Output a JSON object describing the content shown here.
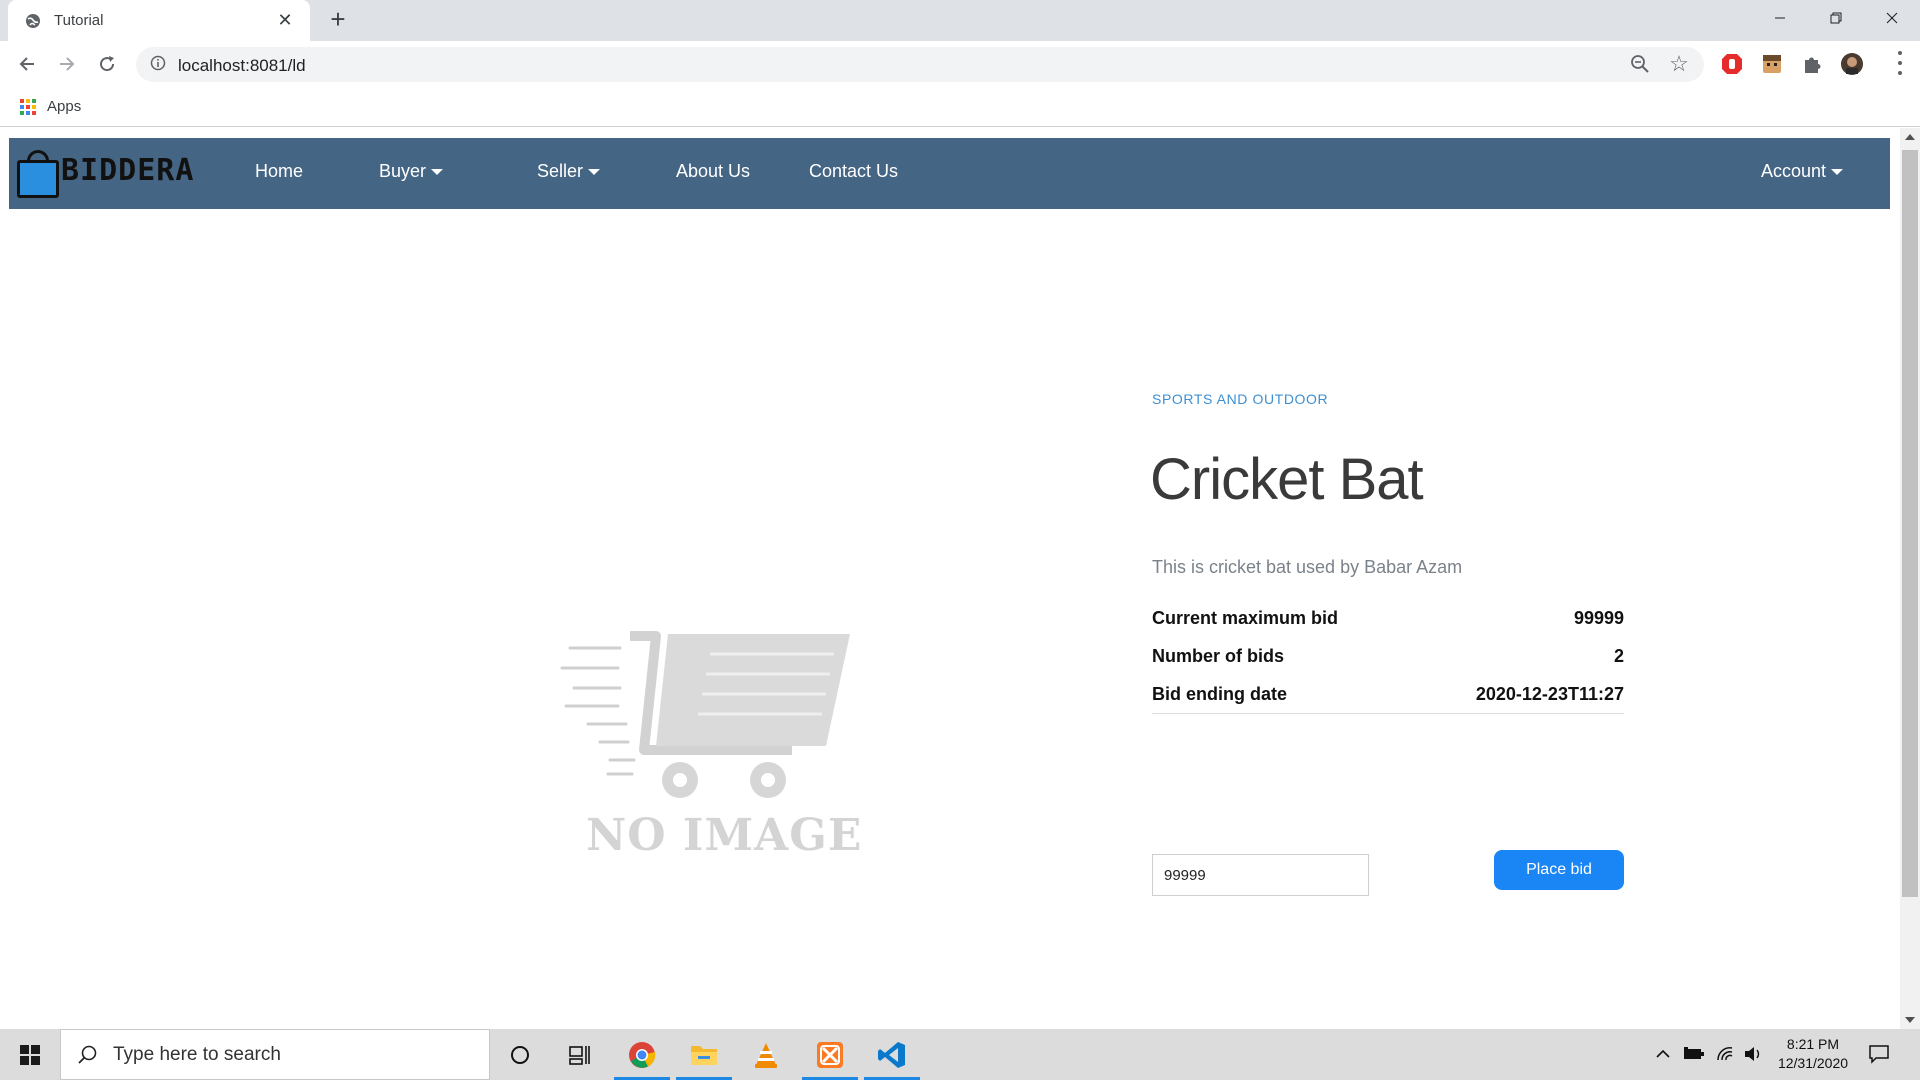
{
  "browser": {
    "tab_title": "Tutorial",
    "url": "localhost:8081/ld",
    "bookmarks_apps_label": "Apps"
  },
  "site": {
    "logo_text": "BIDDERA",
    "nav": {
      "home": "Home",
      "buyer": "Buyer",
      "seller": "Seller",
      "about": "About Us",
      "contact": "Contact Us",
      "account": "Account"
    },
    "colors": {
      "navbar": "#456584",
      "category": "#3d8fd1",
      "button": "#1a85f5"
    }
  },
  "product": {
    "placeholder_image_text": "NO IMAGE",
    "category": "SPORTS AND OUTDOOR",
    "title": "Cricket Bat",
    "description": "This is cricket bat used by Babar Azam",
    "details": [
      {
        "label": "Current maximum bid",
        "value": "99999"
      },
      {
        "label": "Number of bids",
        "value": "2"
      },
      {
        "label": "Bid ending date",
        "value": "2020-12-23T11:27"
      }
    ],
    "bid_input_value": "99999",
    "place_bid_label": "Place bid"
  },
  "taskbar": {
    "search_placeholder": "Type here to search",
    "time": "8:21 PM",
    "date": "12/31/2020"
  }
}
